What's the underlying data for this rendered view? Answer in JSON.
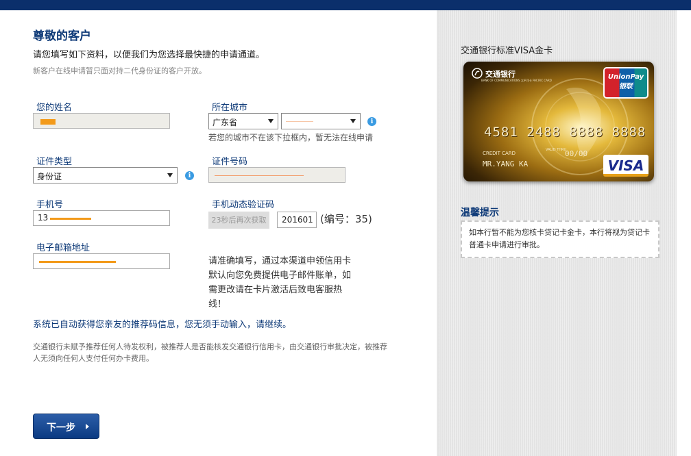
{
  "header": {
    "title": "尊敬的客户",
    "subtitle": "请您填写如下资料，以便我们为您选择最快捷的申请通道。",
    "note": "新客户在线申请暂只面对持二代身份证的客户开放。"
  },
  "form": {
    "name": {
      "label": "您的姓名"
    },
    "city": {
      "label": "所在城市",
      "province_value": "广东省",
      "city_value": "",
      "hint": "若您的城市不在该下拉框内，暂无法在线申请"
    },
    "id_type": {
      "label": "证件类型",
      "value": "身份证"
    },
    "id_number": {
      "label": "证件号码"
    },
    "mobile": {
      "label": "手机号",
      "value": "13"
    },
    "sms_code": {
      "label": "手机动态验证码",
      "resend_button": "23秒后再次获取",
      "value": "201601",
      "serial_note": "(编号：35)"
    },
    "email": {
      "label": "电子邮箱地址",
      "tip": "请准确填写，通过本渠道申领信用卡默认向您免费提供电子邮件账单，如需更改请在卡片激活后致电客服热线！"
    }
  },
  "referral_notice": "系统已自动获得您亲友的推荐码信息，您无须手动输入，请继续。",
  "disclaimer": "交通银行未赋予推荐任何人待发权利，被推荐人是否能核发交通银行信用卡，由交通银行审批决定，被推荐人无须向任何人支付任何办卡费用。",
  "next_button": "下一步",
  "sidebar": {
    "card_title": "交通银行标准VISA金卡",
    "card": {
      "bank_name": "交通银行",
      "bank_name_en": "BANK OF COMMUNICATIONS  太平洋卡  PACIFIC CARD",
      "unionpay": "UnionPay",
      "unionpay_cn": "银联",
      "number": "4581 2488 8888 8888",
      "card_type": "CREDIT CARD",
      "valid_thru": "VALID THRU",
      "expiry": "00/00",
      "holder": "MR.YANG KA",
      "network": "VISA"
    },
    "tip_title": "温馨提示",
    "tip_text": "如本行暂不能为您核卡贷记卡金卡，本行将视为贷记卡普通卡申请进行审批。"
  },
  "colors": {
    "brand_navy": "#0e3a78",
    "topbar": "#0b2f6b",
    "redaction": "#f39a1a",
    "info_icon": "#3a9be2"
  }
}
